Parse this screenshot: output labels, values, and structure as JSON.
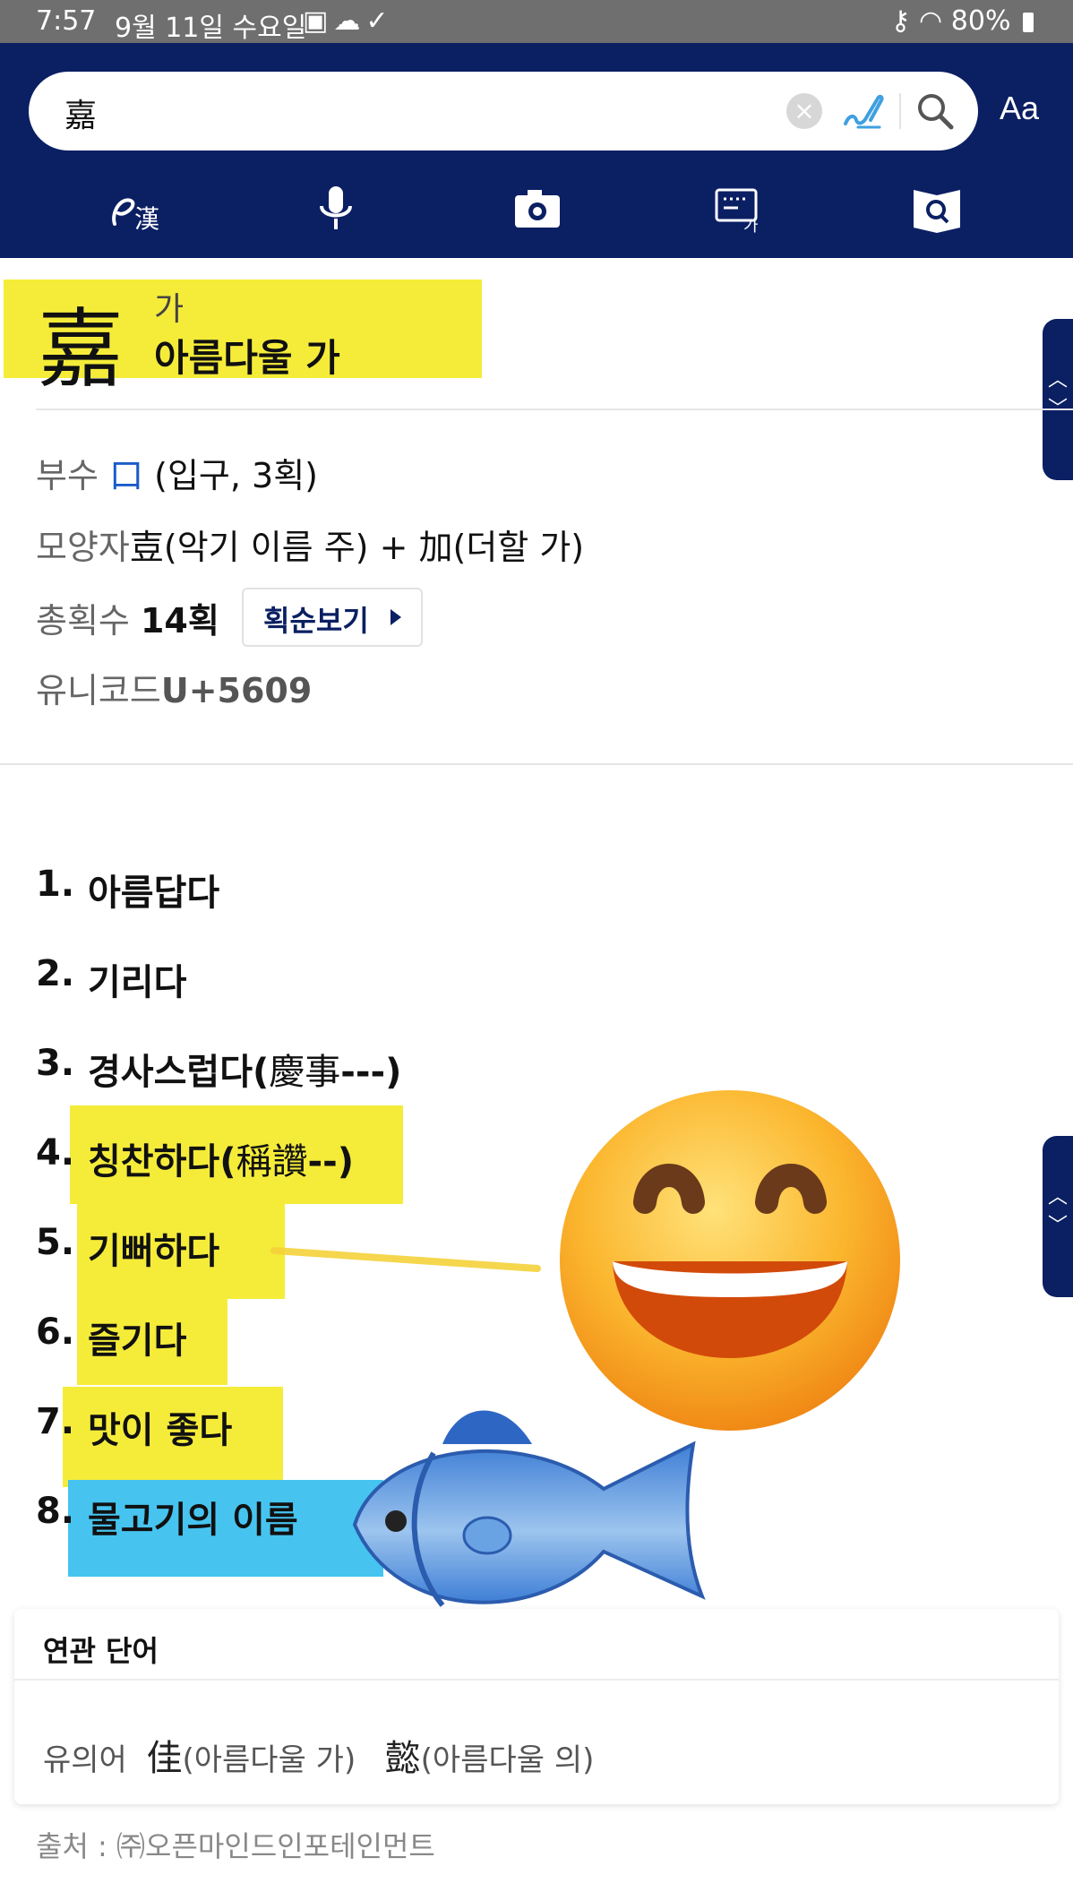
{
  "status_bar": {
    "time": "7:57",
    "date": "9월 11일 수요일",
    "battery": "80%"
  },
  "search": {
    "query": "嘉",
    "font_size_label": "Aa"
  },
  "toolbar": {
    "tools": [
      "handwriting-hanja",
      "voice",
      "camera",
      "keyboard-hangul",
      "dictionary-search"
    ]
  },
  "entry": {
    "hanja": "嘉",
    "reading": "가",
    "meaning": "아름다울 가"
  },
  "info": {
    "radical_label": "부수",
    "radical_char": "口",
    "radical_desc": "(입구, 3획)",
    "shape_label": "모양자",
    "shape_value": "壴(악기 이름 주) + 加(더할 가)",
    "strokes_label": "총획수",
    "strokes_value": "14획",
    "stroke_order_button": "획순보기",
    "unicode_label": "유니코드",
    "unicode_value": "U+5609"
  },
  "definitions": [
    {
      "num": "1.",
      "text": "아름답다",
      "hanja": ""
    },
    {
      "num": "2.",
      "text": "기리다",
      "hanja": ""
    },
    {
      "num": "3.",
      "text": "경사스럽다(",
      "hanja": "慶事",
      "tail": "---)"
    },
    {
      "num": "4.",
      "text": "칭찬하다(",
      "hanja": "稱讚",
      "tail": "--)"
    },
    {
      "num": "5.",
      "text": "기뻐하다",
      "hanja": ""
    },
    {
      "num": "6.",
      "text": "즐기다",
      "hanja": ""
    },
    {
      "num": "7.",
      "text": "맛이 좋다",
      "hanja": ""
    },
    {
      "num": "8.",
      "text": "물고기의 이름",
      "hanja": ""
    }
  ],
  "related": {
    "title": "연관 단어",
    "synonym_label": "유의어",
    "items": [
      {
        "hanja": "佳",
        "desc": "(아름다울 가)"
      },
      {
        "hanja": "懿",
        "desc": "(아름다울 의)"
      }
    ]
  },
  "source": "출처 : ㈜오픈마인드인포테인먼트",
  "colors": {
    "header_navy": "#0b1f63",
    "highlight_yellow": "#f5ec3a",
    "highlight_blue": "#46c4ef"
  },
  "stickers": [
    "grinning-face-emoji",
    "fish-emoji"
  ]
}
